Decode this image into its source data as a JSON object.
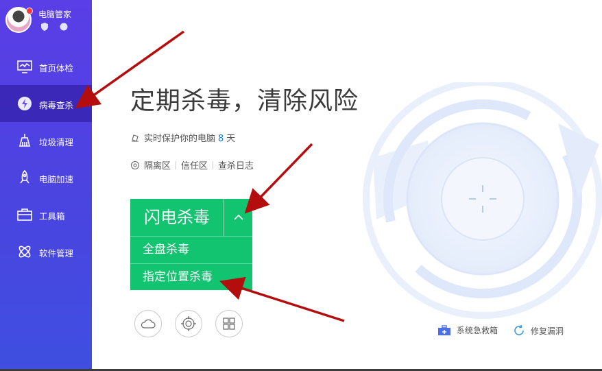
{
  "profile": {
    "app_name": "电脑管家"
  },
  "nav": {
    "items": [
      {
        "label": "首页体检"
      },
      {
        "label": "病毒查杀"
      },
      {
        "label": "垃圾清理"
      },
      {
        "label": "电脑加速"
      },
      {
        "label": "工具箱"
      },
      {
        "label": "软件管理"
      }
    ],
    "active_index": 1
  },
  "main": {
    "headline": "定期杀毒，清除风险",
    "protection": {
      "prefix": "实时保护你的电脑",
      "days": "8",
      "suffix": "天"
    },
    "links": [
      "隔离区",
      "信任区",
      "查杀日志"
    ],
    "scan": {
      "primary": "闪电杀毒",
      "options": [
        "全盘杀毒",
        "指定位置杀毒"
      ]
    },
    "tools": {
      "rescue": "系统急救箱",
      "repair": "修复漏洞"
    }
  },
  "colors": {
    "sidebar": "#4a44e0",
    "active": "#2d1c96",
    "scan": "#12c36f",
    "accent": "#1a7ce0",
    "annotation_arrow": "#b40d0d"
  },
  "icons": [
    "shirt-icon",
    "menu-icon",
    "minimize-icon",
    "close-icon",
    "cloud-icon",
    "target-icon",
    "windows-icon",
    "toolbox-icon",
    "refresh-icon"
  ]
}
